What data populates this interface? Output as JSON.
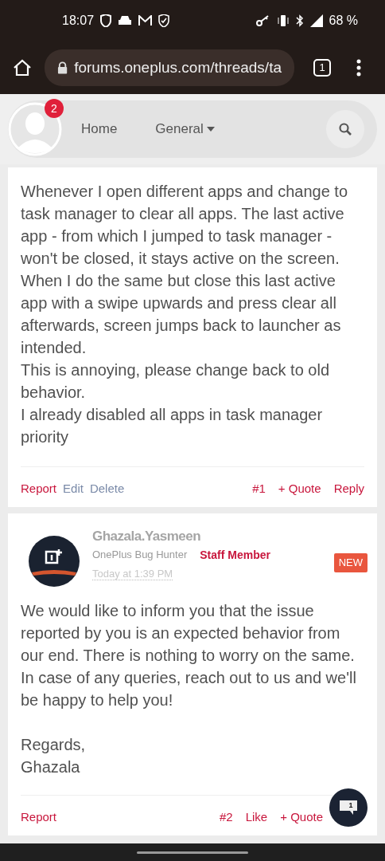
{
  "status_bar": {
    "time": "18:07",
    "battery": "68 %"
  },
  "browser": {
    "url": "forums.oneplus.com/threads/ta",
    "tab_count": "1"
  },
  "nav": {
    "notification_count": "2",
    "items": [
      {
        "label": "Home",
        "dropdown": false
      },
      {
        "label": "General",
        "dropdown": true
      }
    ]
  },
  "posts": [
    {
      "paragraphs": [
        "Whenever I open different apps and change to task manager to clear all apps. The last active app - from which I jumped to task manager - won't be closed, it stays active on the screen.",
        "When I do the same but close this last active app with a swipe upwards and press clear all afterwards, screen jumps back to launcher as intended.",
        "This is annoying, please change back to old behavior.",
        "I already disabled all apps in task manager priority"
      ],
      "left_actions": [
        {
          "label": "Report",
          "kind": "danger"
        },
        {
          "label": "Edit",
          "kind": "muted"
        },
        {
          "label": "Delete",
          "kind": "muted"
        }
      ],
      "right_actions": [
        "#1",
        "+ Quote",
        "Reply"
      ]
    },
    {
      "author": {
        "name": "Ghazala.Yasmeen",
        "title": "OnePlus Bug Hunter",
        "badge": "Staff Member",
        "time": "Today at 1:39 PM",
        "new_label": "NEW"
      },
      "paragraphs": [
        "We would like to inform you that the issue reported by you is an expected behavior from our end. There is nothing to worry on the same. In case of any queries, reach out to us and we'll be happy to help you!"
      ],
      "signature": "Regards,\nGhazala",
      "left_actions": [
        {
          "label": "Report",
          "kind": "danger"
        }
      ],
      "right_actions": [
        "#2",
        "Like",
        "+ Quote"
      ]
    }
  ],
  "chat_count": "1"
}
